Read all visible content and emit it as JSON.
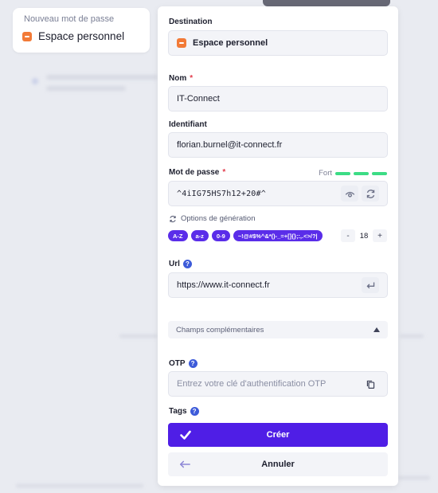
{
  "left_card": {
    "title": "Nouveau mot de passe",
    "vault_name": "Espace personnel"
  },
  "form": {
    "destination": {
      "label": "Destination",
      "value": "Espace personnel",
      "icon": "vault-icon"
    },
    "name": {
      "label": "Nom",
      "required_mark": "*",
      "value": "IT-Connect"
    },
    "identifier": {
      "label": "Identifiant",
      "value": "florian.burnel@it-connect.fr"
    },
    "password": {
      "label": "Mot de passe",
      "required_mark": "*",
      "strength_label": "Fort",
      "strength_bars": 3,
      "value": "^4iIG75HS7h12+20#^",
      "icons": [
        "eye-icon",
        "refresh-icon"
      ]
    },
    "generation": {
      "label": "Options de génération",
      "chips": [
        "A-Z",
        "a-z",
        "0-9",
        "~!@#$%^&*()-_=+[]{};:,.<>/?|"
      ],
      "length": "18",
      "decrement": "-",
      "increment": "+"
    },
    "url": {
      "label": "Url",
      "help": "?",
      "value": "https://www.it-connect.fr",
      "icon": "enter-icon"
    },
    "extra_fields": {
      "label": "Champs complémentaires"
    },
    "otp": {
      "label": "OTP",
      "help": "?",
      "placeholder": "Entrez votre clé d'authentification OTP",
      "icon": "copy-icon"
    },
    "tags": {
      "label": "Tags",
      "help": "?"
    }
  },
  "actions": {
    "create": "Créer",
    "cancel": "Annuler"
  },
  "colors": {
    "primary": "#4f1ee6",
    "chip": "#5a2de9",
    "strength": "#3cdc85",
    "vault_orange": "#f27a37",
    "required": "#e23a4a"
  }
}
